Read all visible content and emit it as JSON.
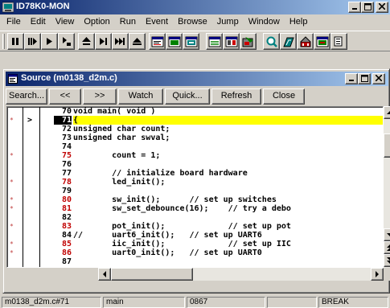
{
  "app": {
    "title": "ID78K0-MON",
    "caption_buttons": [
      "minimize",
      "maximize",
      "close"
    ]
  },
  "menu": [
    "File",
    "Edit",
    "View",
    "Option",
    "Run",
    "Event",
    "Browse",
    "Jump",
    "Window",
    "Help"
  ],
  "toolbar": {
    "icons": [
      "stop-icon",
      "restart-icon",
      "go-icon",
      "step-in-icon",
      "return-icon",
      "come-here-icon",
      "ignore-break-icon",
      "eject-icon",
      "source-window-icon",
      "assemble-window-icon",
      "memory-window-icon",
      "register-window-icon",
      "sfr-window-icon",
      "local-variable-icon",
      "quick-watch-icon",
      "watch-window-icon",
      "stack-trace-icon",
      "event-icon",
      "more-icon"
    ]
  },
  "source_window": {
    "title": "Source (m0138_d2m.c)",
    "buttons": [
      "Search...",
      "<<",
      ">>",
      "Watch",
      "Quick...",
      "Refresh",
      "Close"
    ],
    "current_line": 71,
    "lines": [
      {
        "num": "70",
        "mark": "",
        "arrow": "",
        "code": "void main( void )",
        "prefix": ""
      },
      {
        "num": "71",
        "mark": "*",
        "arrow": ">",
        "code": "{",
        "prefix": ""
      },
      {
        "num": "72",
        "mark": "",
        "arrow": "",
        "code": "unsigned char count;",
        "prefix": ""
      },
      {
        "num": "73",
        "mark": "",
        "arrow": "",
        "code": "unsigned char swval;",
        "prefix": ""
      },
      {
        "num": "74",
        "mark": "",
        "arrow": "",
        "code": "",
        "prefix": ""
      },
      {
        "num": "75",
        "mark": "*",
        "arrow": "",
        "code": "        count = 1;",
        "prefix": ""
      },
      {
        "num": "76",
        "mark": "",
        "arrow": "",
        "code": "",
        "prefix": ""
      },
      {
        "num": "77",
        "mark": "",
        "arrow": "",
        "code": "        // initialize board hardware",
        "prefix": ""
      },
      {
        "num": "78",
        "mark": "*",
        "arrow": "",
        "code": "        led_init();",
        "prefix": ""
      },
      {
        "num": "79",
        "mark": "",
        "arrow": "",
        "code": "",
        "prefix": ""
      },
      {
        "num": "80",
        "mark": "*",
        "arrow": "",
        "code": "        sw_init();      // set up switches",
        "prefix": ""
      },
      {
        "num": "81",
        "mark": "*",
        "arrow": "",
        "code": "        sw_set_debounce(16);    // try a debo",
        "prefix": ""
      },
      {
        "num": "82",
        "mark": "",
        "arrow": "",
        "code": "",
        "prefix": ""
      },
      {
        "num": "83",
        "mark": "*",
        "arrow": "",
        "code": "        pot_init();             // set up pot",
        "prefix": ""
      },
      {
        "num": "84",
        "mark": "",
        "arrow": "",
        "code": "        uart6_init();   // set up UART6",
        "prefix": "//"
      },
      {
        "num": "85",
        "mark": "*",
        "arrow": "",
        "code": "        iic_init();             // set up IIC",
        "prefix": ""
      },
      {
        "num": "86",
        "mark": "*",
        "arrow": "",
        "code": "        uart0_init();   // set up UART0",
        "prefix": ""
      },
      {
        "num": "87",
        "mark": "",
        "arrow": "",
        "code": "",
        "prefix": ""
      }
    ]
  },
  "status": {
    "file": "m0138_d2m.c#71",
    "function": "main",
    "address": "0867",
    "blank": "",
    "state": "BREAK"
  },
  "colors": {
    "titlebar_start": "#0a246a",
    "titlebar_end": "#a6caf0",
    "current_line": "#ffff00",
    "break_mark": "#c00000"
  }
}
